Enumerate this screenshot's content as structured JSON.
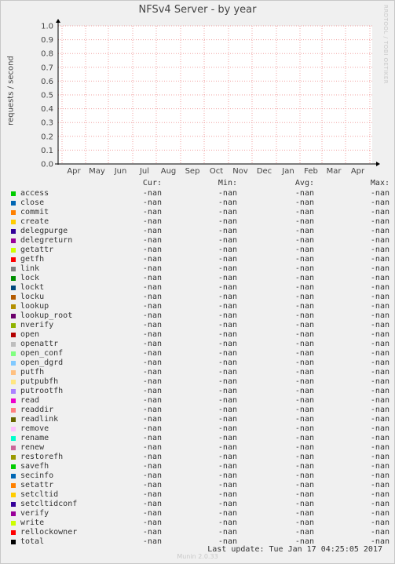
{
  "title": "NFSv4 Server - by year",
  "watermark": "RRDTOOL / TOBI OETIKER",
  "footer": "Last update: Tue Jan 17 04:25:05 2017",
  "branding": "Munin 2.0.33",
  "colors": {
    "grid": "#f0a0a0",
    "axis": "#000000",
    "background": "#ffffff"
  },
  "chart_data": {
    "type": "line",
    "title": "NFSv4 Server - by year",
    "ylabel": "requests / second",
    "ylim": [
      0.0,
      1.0
    ],
    "yticks": [
      "0.0",
      "0.1",
      "0.2",
      "0.3",
      "0.4",
      "0.5",
      "0.6",
      "0.7",
      "0.8",
      "0.9",
      "1.0"
    ],
    "categories": [
      "Apr",
      "May",
      "Jun",
      "Jul",
      "Aug",
      "Sep",
      "Oct",
      "Nov",
      "Dec",
      "Jan",
      "Feb",
      "Mar",
      "Apr"
    ],
    "grid": true,
    "series": []
  },
  "legend": {
    "headers": [
      "Cur:",
      "Min:",
      "Avg:",
      "Max:"
    ],
    "items": [
      {
        "name": "access",
        "color": "#00cc00",
        "cur": "-nan",
        "min": "-nan",
        "avg": "-nan",
        "max": "-nan"
      },
      {
        "name": "close",
        "color": "#0066b3",
        "cur": "-nan",
        "min": "-nan",
        "avg": "-nan",
        "max": "-nan"
      },
      {
        "name": "commit",
        "color": "#ff8000",
        "cur": "-nan",
        "min": "-nan",
        "avg": "-nan",
        "max": "-nan"
      },
      {
        "name": "create",
        "color": "#ffcc00",
        "cur": "-nan",
        "min": "-nan",
        "avg": "-nan",
        "max": "-nan"
      },
      {
        "name": "delegpurge",
        "color": "#330099",
        "cur": "-nan",
        "min": "-nan",
        "avg": "-nan",
        "max": "-nan"
      },
      {
        "name": "delegreturn",
        "color": "#990099",
        "cur": "-nan",
        "min": "-nan",
        "avg": "-nan",
        "max": "-nan"
      },
      {
        "name": "getattr",
        "color": "#ccff00",
        "cur": "-nan",
        "min": "-nan",
        "avg": "-nan",
        "max": "-nan"
      },
      {
        "name": "getfh",
        "color": "#ff0000",
        "cur": "-nan",
        "min": "-nan",
        "avg": "-nan",
        "max": "-nan"
      },
      {
        "name": "link",
        "color": "#808080",
        "cur": "-nan",
        "min": "-nan",
        "avg": "-nan",
        "max": "-nan"
      },
      {
        "name": "lock",
        "color": "#008f00",
        "cur": "-nan",
        "min": "-nan",
        "avg": "-nan",
        "max": "-nan"
      },
      {
        "name": "lockt",
        "color": "#00487d",
        "cur": "-nan",
        "min": "-nan",
        "avg": "-nan",
        "max": "-nan"
      },
      {
        "name": "locku",
        "color": "#b35a00",
        "cur": "-nan",
        "min": "-nan",
        "avg": "-nan",
        "max": "-nan"
      },
      {
        "name": "lookup",
        "color": "#b38f00",
        "cur": "-nan",
        "min": "-nan",
        "avg": "-nan",
        "max": "-nan"
      },
      {
        "name": "lookup_root",
        "color": "#6b006b",
        "cur": "-nan",
        "min": "-nan",
        "avg": "-nan",
        "max": "-nan"
      },
      {
        "name": "nverify",
        "color": "#8fb300",
        "cur": "-nan",
        "min": "-nan",
        "avg": "-nan",
        "max": "-nan"
      },
      {
        "name": "open",
        "color": "#b30000",
        "cur": "-nan",
        "min": "-nan",
        "avg": "-nan",
        "max": "-nan"
      },
      {
        "name": "openattr",
        "color": "#bebebe",
        "cur": "-nan",
        "min": "-nan",
        "avg": "-nan",
        "max": "-nan"
      },
      {
        "name": "open_conf",
        "color": "#80ff80",
        "cur": "-nan",
        "min": "-nan",
        "avg": "-nan",
        "max": "-nan"
      },
      {
        "name": "open_dgrd",
        "color": "#80c9ff",
        "cur": "-nan",
        "min": "-nan",
        "avg": "-nan",
        "max": "-nan"
      },
      {
        "name": "putfh",
        "color": "#ffc080",
        "cur": "-nan",
        "min": "-nan",
        "avg": "-nan",
        "max": "-nan"
      },
      {
        "name": "putpubfh",
        "color": "#ffe680",
        "cur": "-nan",
        "min": "-nan",
        "avg": "-nan",
        "max": "-nan"
      },
      {
        "name": "putrootfh",
        "color": "#aa80ff",
        "cur": "-nan",
        "min": "-nan",
        "avg": "-nan",
        "max": "-nan"
      },
      {
        "name": "read",
        "color": "#ee00cc",
        "cur": "-nan",
        "min": "-nan",
        "avg": "-nan",
        "max": "-nan"
      },
      {
        "name": "readdir",
        "color": "#ff8080",
        "cur": "-nan",
        "min": "-nan",
        "avg": "-nan",
        "max": "-nan"
      },
      {
        "name": "readlink",
        "color": "#666600",
        "cur": "-nan",
        "min": "-nan",
        "avg": "-nan",
        "max": "-nan"
      },
      {
        "name": "remove",
        "color": "#ffbfff",
        "cur": "-nan",
        "min": "-nan",
        "avg": "-nan",
        "max": "-nan"
      },
      {
        "name": "rename",
        "color": "#00ffcc",
        "cur": "-nan",
        "min": "-nan",
        "avg": "-nan",
        "max": "-nan"
      },
      {
        "name": "renew",
        "color": "#cc6699",
        "cur": "-nan",
        "min": "-nan",
        "avg": "-nan",
        "max": "-nan"
      },
      {
        "name": "restorefh",
        "color": "#999900",
        "cur": "-nan",
        "min": "-nan",
        "avg": "-nan",
        "max": "-nan"
      },
      {
        "name": "savefh",
        "color": "#00cc00",
        "cur": "-nan",
        "min": "-nan",
        "avg": "-nan",
        "max": "-nan"
      },
      {
        "name": "secinfo",
        "color": "#0066b3",
        "cur": "-nan",
        "min": "-nan",
        "avg": "-nan",
        "max": "-nan"
      },
      {
        "name": "setattr",
        "color": "#ff8000",
        "cur": "-nan",
        "min": "-nan",
        "avg": "-nan",
        "max": "-nan"
      },
      {
        "name": "setcltid",
        "color": "#ffcc00",
        "cur": "-nan",
        "min": "-nan",
        "avg": "-nan",
        "max": "-nan"
      },
      {
        "name": "setcltidconf",
        "color": "#330099",
        "cur": "-nan",
        "min": "-nan",
        "avg": "-nan",
        "max": "-nan"
      },
      {
        "name": "verify",
        "color": "#990099",
        "cur": "-nan",
        "min": "-nan",
        "avg": "-nan",
        "max": "-nan"
      },
      {
        "name": "write",
        "color": "#ccff00",
        "cur": "-nan",
        "min": "-nan",
        "avg": "-nan",
        "max": "-nan"
      },
      {
        "name": "rellockowner",
        "color": "#ff0000",
        "cur": "-nan",
        "min": "-nan",
        "avg": "-nan",
        "max": "-nan"
      },
      {
        "name": "total",
        "color": "#000000",
        "cur": "-nan",
        "min": "-nan",
        "avg": "-nan",
        "max": "-nan"
      }
    ]
  }
}
